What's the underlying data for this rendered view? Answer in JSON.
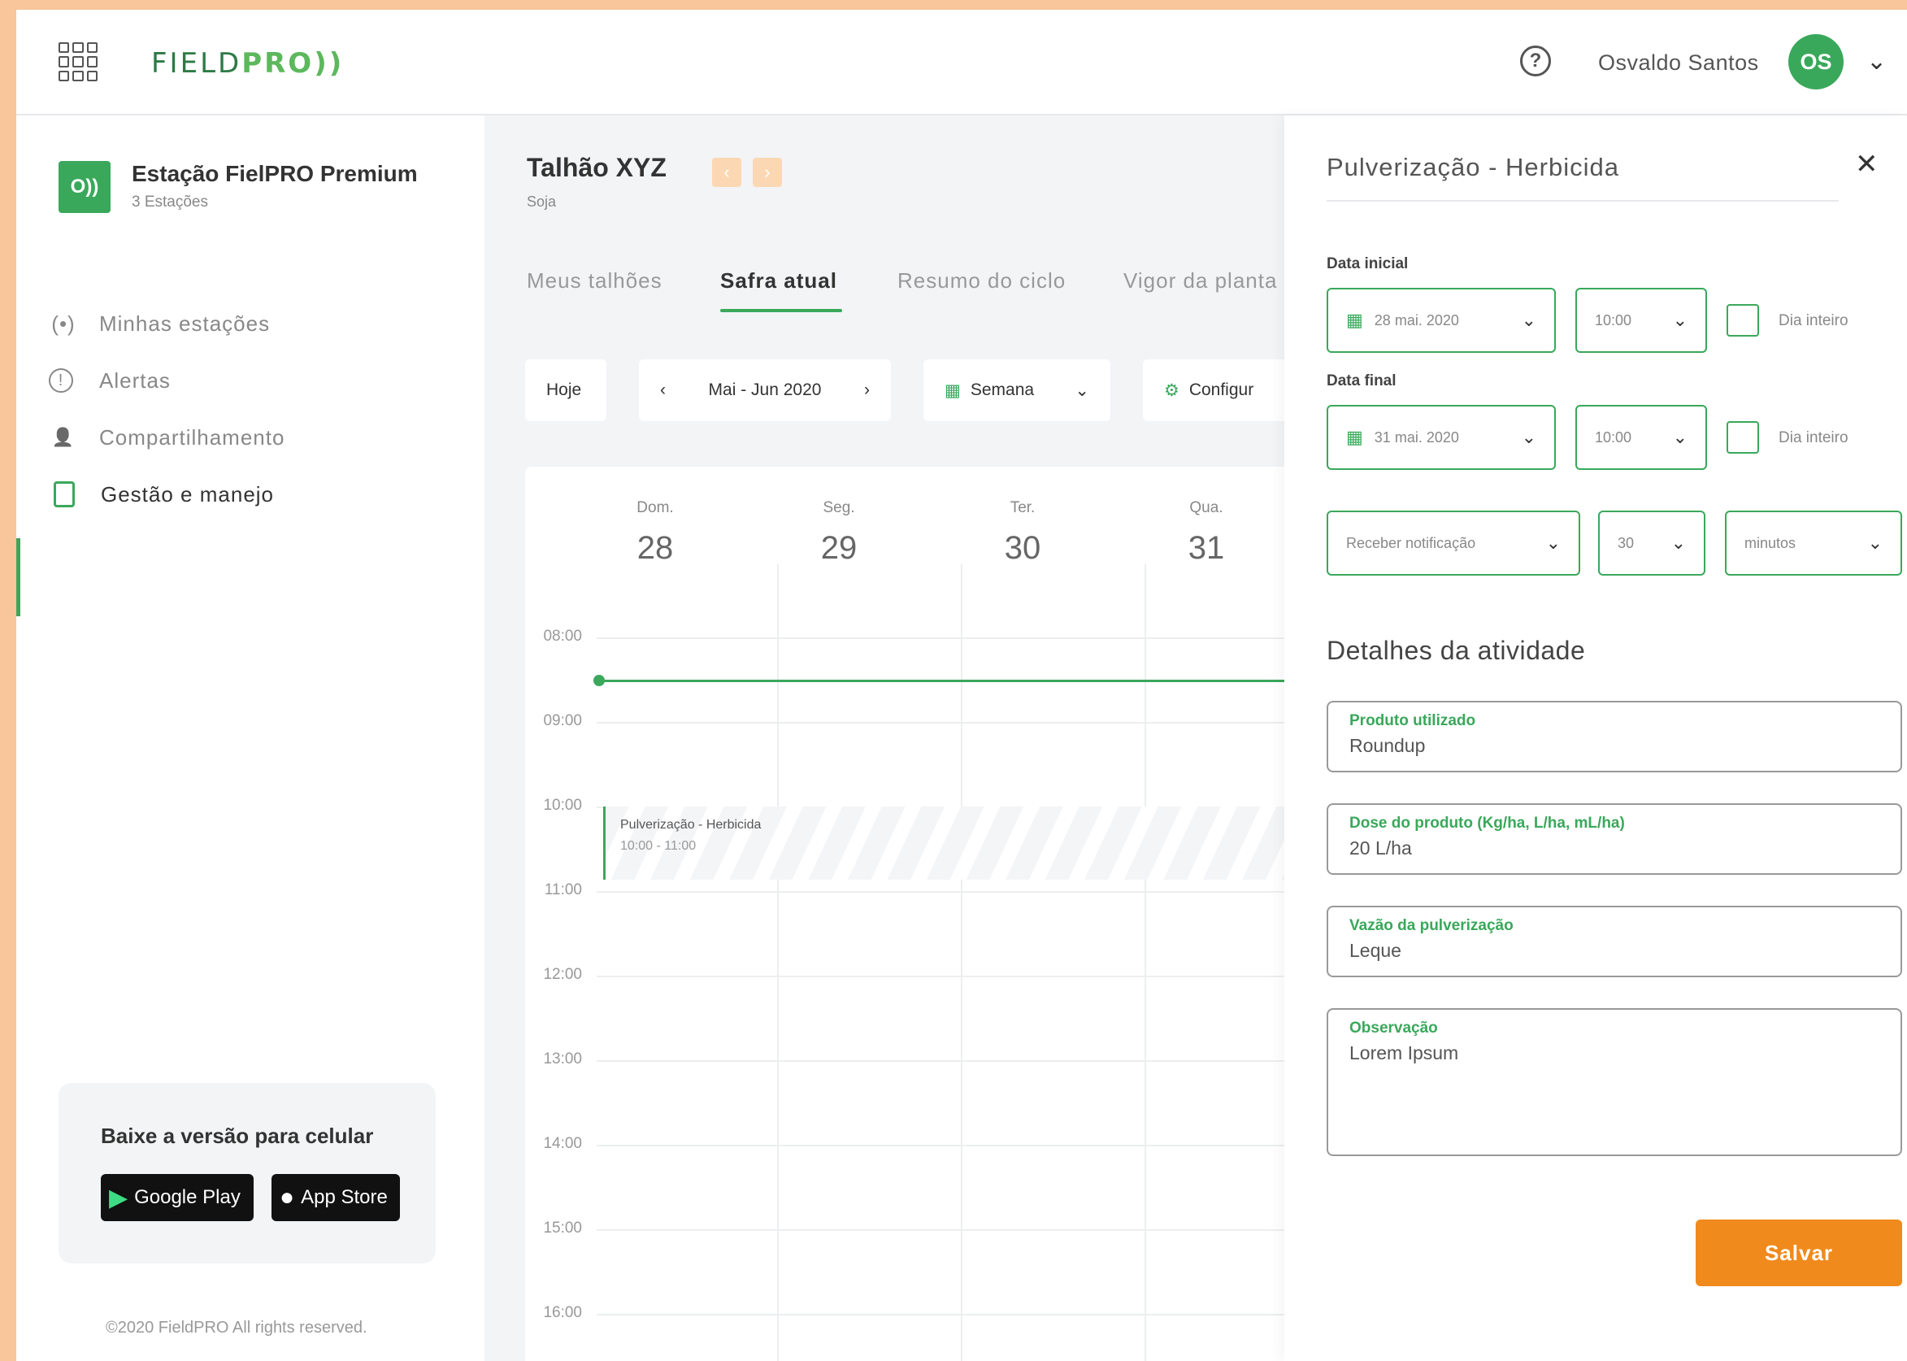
{
  "header": {
    "logo_main": "FIELD",
    "logo_accent": "PRO",
    "logo_mark": "))",
    "help_icon": "?",
    "user_name": "Osvaldo Santos",
    "avatar_initials": "OS"
  },
  "sidebar": {
    "station_icon": "O))",
    "station_title": "Estação FielPRO Premium",
    "station_sub": "3 Estações",
    "items": [
      {
        "label": "Minhas estações",
        "icon": "(•)",
        "active": false
      },
      {
        "label": "Alertas",
        "icon": "!",
        "active": false
      },
      {
        "label": "Compartilhamento",
        "icon": "👤",
        "active": false
      },
      {
        "label": "Gestão e manejo",
        "icon": "📋",
        "active": true
      }
    ],
    "app_card_title": "Baixe a versão para celular",
    "google_play": "Google Play",
    "app_store": "App Store",
    "copyright": "©2020 FieldPRO All rights reserved."
  },
  "main": {
    "title": "Talhão XYZ",
    "subtitle": "Soja",
    "tabs": [
      "Meus talhões",
      "Safra atual",
      "Resumo do ciclo",
      "Vigor da planta"
    ],
    "today_button": "Hoje",
    "date_range": "Mai - Jun 2020",
    "view_select": "Semana",
    "configure_button": "Configur",
    "days": [
      {
        "name": "Dom.",
        "num": "28"
      },
      {
        "name": "Seg.",
        "num": "29"
      },
      {
        "name": "Ter.",
        "num": "30"
      },
      {
        "name": "Qua.",
        "num": "31"
      }
    ],
    "hours": [
      "08:00",
      "09:00",
      "10:00",
      "11:00",
      "12:00",
      "13:00",
      "14:00",
      "15:00",
      "16:00"
    ],
    "event": {
      "title": "Pulverização - Herbicida",
      "time": "10:00 - 11:00"
    }
  },
  "panel": {
    "title": "Pulverização - Herbicida",
    "start_label": "Data inicial",
    "start_date": "28 mai. 2020",
    "start_time": "10:00",
    "end_label": "Data final",
    "end_date": "31 mai. 2020",
    "end_time": "10:00",
    "all_day": "Dia inteiro",
    "notify_placeholder": "Receber notificação",
    "notify_amount": "30",
    "notify_unit": "minutos",
    "details_title": "Detalhes da atividade",
    "fields": [
      {
        "label": "Produto utilizado",
        "value": "Roundup"
      },
      {
        "label": "Dose do produto (Kg/ha, L/ha, mL/ha)",
        "value": "20 L/ha"
      },
      {
        "label": "Vazão da pulverização",
        "value": "Leque"
      },
      {
        "label": "Observação",
        "value": "Lorem Ipsum"
      }
    ],
    "save_button": "Salvar"
  },
  "colors": {
    "brand_green": "#3aa85b",
    "accent_orange": "#f08a1c",
    "frame": "#f9c59b"
  }
}
